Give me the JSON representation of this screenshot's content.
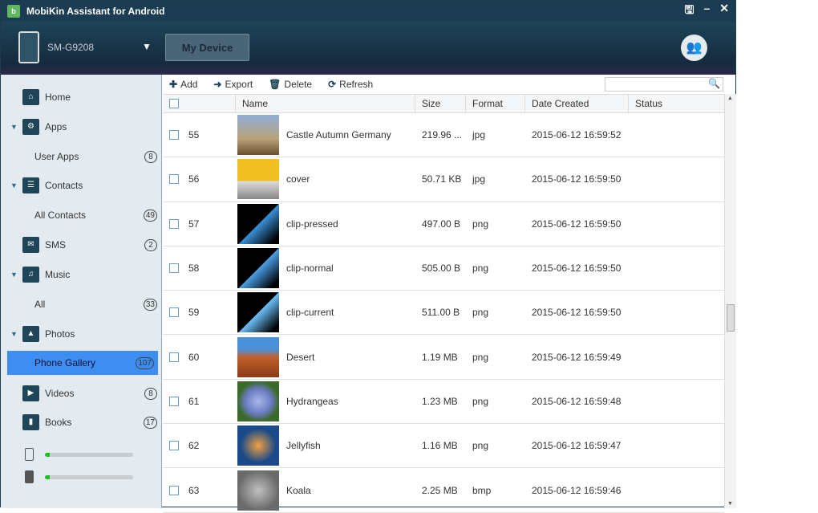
{
  "app": {
    "title": "MobiKin Assistant for Android",
    "controls": [
      "🖫",
      "–",
      "✕"
    ]
  },
  "header": {
    "device_name": "SM-G9208",
    "my_device": "My Device"
  },
  "sidebar": {
    "items": [
      {
        "label": "Home",
        "icon": "home-icon",
        "g": "⌂"
      },
      {
        "label": "Apps",
        "icon": "apps-icon",
        "g": "⚙",
        "arrow": "▼"
      },
      {
        "label": "User Apps",
        "count": "8",
        "sub": true
      },
      {
        "label": "Contacts",
        "icon": "contacts-icon",
        "g": "☰",
        "arrow": "▼"
      },
      {
        "label": "All Contacts",
        "count": "49",
        "sub": true
      },
      {
        "label": "SMS",
        "icon": "sms-icon",
        "g": "✉",
        "count": "2"
      },
      {
        "label": "Music",
        "icon": "music-icon",
        "g": "♫",
        "arrow": "▼"
      },
      {
        "label": "All",
        "count": "33",
        "sub": true
      },
      {
        "label": "Photos",
        "icon": "photos-icon",
        "g": "▲",
        "arrow": "▼"
      },
      {
        "label": "Phone Gallery",
        "count": "107",
        "sub": true,
        "selected": true
      },
      {
        "label": "Videos",
        "icon": "videos-icon",
        "g": "▶",
        "count": "8"
      },
      {
        "label": "Books",
        "icon": "books-icon",
        "g": "▮",
        "count": "17"
      }
    ],
    "storage": [
      {
        "type": "internal",
        "fill_percent": 5
      },
      {
        "type": "sd-card",
        "fill_percent": 5
      }
    ]
  },
  "toolbar": {
    "add": "Add",
    "export": "Export",
    "delete": "Delete",
    "refresh": "Refresh",
    "search_placeholder": ""
  },
  "table": {
    "headers": [
      "Name",
      "Size",
      "Format",
      "Date Created",
      "Status"
    ],
    "rows": [
      {
        "num": "55",
        "name": "Castle Autumn Germany",
        "size": "219.96 ...",
        "format": "jpg",
        "date": "2015-06-12 16:59:52",
        "thumb": "linear-gradient(#8fb0d8,#b9a27a 60%,#6a5030)"
      },
      {
        "num": "56",
        "name": "cover",
        "size": "50.71 KB",
        "format": "jpg",
        "date": "2015-06-12 16:59:50",
        "thumb": "linear-gradient(#f0c020 55%,#ddd 55%,#888)"
      },
      {
        "num": "57",
        "name": "clip-pressed",
        "size": "497.00 B",
        "format": "png",
        "date": "2015-06-12 16:59:50",
        "thumb": "linear-gradient(135deg,#000 50%,#3a8fd8 51%,#000 90%)"
      },
      {
        "num": "58",
        "name": "clip-normal",
        "size": "505.00 B",
        "format": "png",
        "date": "2015-06-12 16:59:50",
        "thumb": "linear-gradient(135deg,#000 50%,#4aa0e8 51%,#000 90%)"
      },
      {
        "num": "59",
        "name": "clip-current",
        "size": "511.00 B",
        "format": "png",
        "date": "2015-06-12 16:59:50",
        "thumb": "linear-gradient(135deg,#000 50%,#6cc0f8 51%,#000 90%)"
      },
      {
        "num": "60",
        "name": "Desert",
        "size": "1.19 MB",
        "format": "png",
        "date": "2015-06-12 16:59:49",
        "thumb": "linear-gradient(#4a90d8 30%,#c0602a 50%,#8a3a18)"
      },
      {
        "num": "61",
        "name": "Hydrangeas",
        "size": "1.23 MB",
        "format": "png",
        "date": "2015-06-12 16:59:48",
        "thumb": "radial-gradient(#a8b8e8,#6a7ac0 45%,#3a6a2a 70%)"
      },
      {
        "num": "62",
        "name": "Jellyfish",
        "size": "1.16 MB",
        "format": "png",
        "date": "2015-06-12 16:59:47",
        "thumb": "radial-gradient(#f0a040,#1a4a8a 60%)"
      },
      {
        "num": "63",
        "name": "Koala",
        "size": "2.25 MB",
        "format": "bmp",
        "date": "2015-06-12 16:59:46",
        "thumb": "radial-gradient(#c0c0c0,#6a6a6a 70%)"
      }
    ]
  }
}
